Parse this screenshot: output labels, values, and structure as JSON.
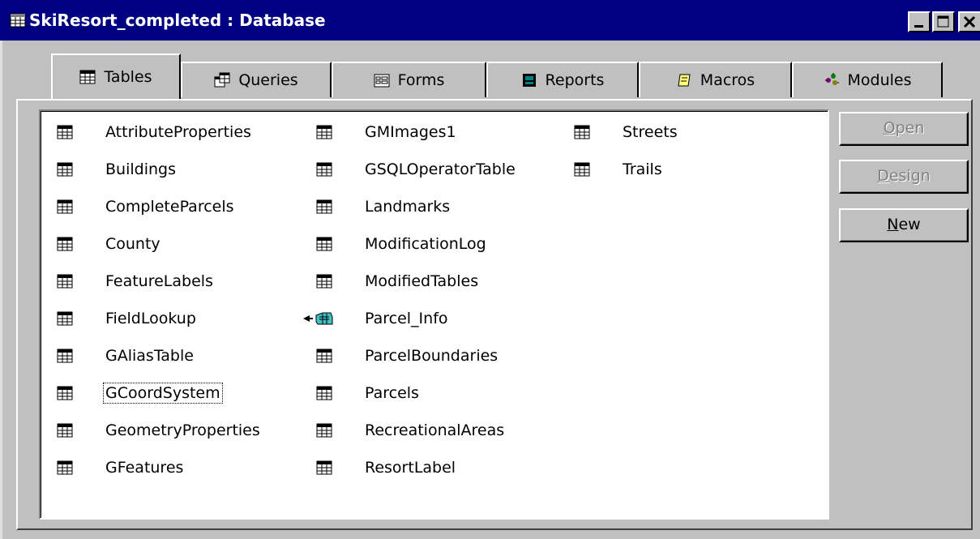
{
  "window": {
    "title": "SkiResort_completed : Database",
    "title_icon": "database-window-icon",
    "colors": {
      "titlebar": "#000080",
      "face": "#c0c0c0",
      "list_bg": "#ffffff"
    }
  },
  "tabs": [
    {
      "label": "Tables",
      "icon": "table-icon",
      "active": true
    },
    {
      "label": "Queries",
      "icon": "query-icon",
      "active": false
    },
    {
      "label": "Forms",
      "icon": "form-icon",
      "active": false
    },
    {
      "label": "Reports",
      "icon": "report-icon",
      "active": false
    },
    {
      "label": "Macros",
      "icon": "macro-icon",
      "active": false
    },
    {
      "label": "Modules",
      "icon": "module-icon",
      "active": false
    }
  ],
  "tables": {
    "column1": [
      "AttributeProperties",
      "Buildings",
      "CompleteParcels",
      "County",
      "FeatureLabels",
      "FieldLookup",
      "GAliasTable",
      "GCoordSystem",
      "GeometryProperties",
      "GFeatures"
    ],
    "column2": [
      "GMImages1",
      "GSQLOperatorTable",
      "Landmarks",
      "ModificationLog",
      "ModifiedTables",
      "Parcel_Info",
      "ParcelBoundaries",
      "Parcels",
      "RecreationalAreas",
      "ResortLabel"
    ],
    "column3": [
      "Streets",
      "Trails"
    ],
    "focused_item": "GCoordSystem",
    "linked_item": "Parcel_Info"
  },
  "buttons": {
    "open": {
      "label_underlined": "O",
      "label_rest": "pen",
      "enabled": false
    },
    "design": {
      "label_underlined": "D",
      "label_rest": "esign",
      "enabled": false
    },
    "new": {
      "label_underlined": "N",
      "label_rest": "ew",
      "enabled": true
    }
  }
}
